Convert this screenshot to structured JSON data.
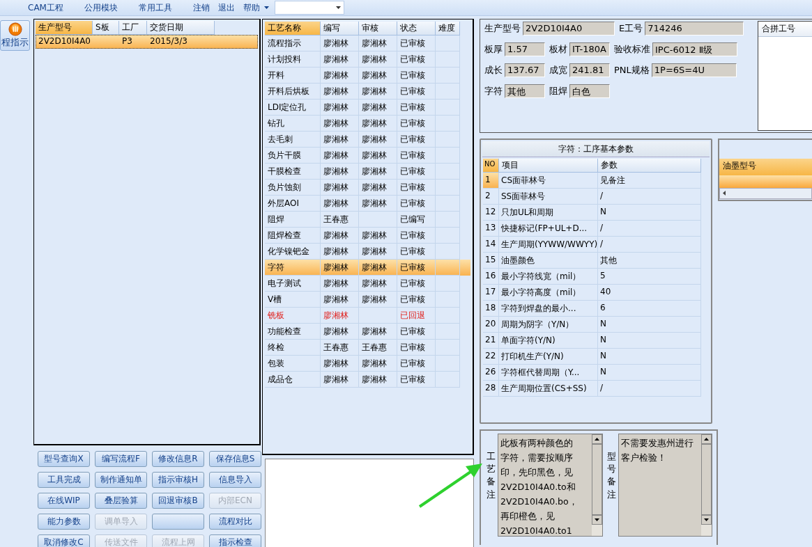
{
  "menu": [
    {
      "label": "CAM工程"
    },
    {
      "label": "公用模块"
    },
    {
      "label": "常用工具"
    },
    {
      "label": "注销"
    },
    {
      "label": "退出"
    },
    {
      "label": "帮助"
    }
  ],
  "side_button": {
    "label": "程指示"
  },
  "model_table": {
    "columns": [
      "生产型号",
      "S板",
      "工厂",
      "交货日期"
    ],
    "rows": [
      {
        "cells": [
          "2V2D10I4A0",
          "",
          "P3",
          "2015/3/3"
        ],
        "selected": true
      }
    ]
  },
  "process_table": {
    "columns": [
      "工艺名称",
      "编写",
      "审核",
      "状态",
      "难度"
    ],
    "rows": [
      {
        "cells": [
          "流程指示",
          "廖湘林",
          "廖湘林",
          "已审核",
          ""
        ],
        "selected": false,
        "returned": false
      },
      {
        "cells": [
          "计划投料",
          "廖湘林",
          "廖湘林",
          "已审核",
          ""
        ],
        "selected": false,
        "returned": false
      },
      {
        "cells": [
          "开料",
          "廖湘林",
          "廖湘林",
          "已审核",
          ""
        ],
        "selected": false,
        "returned": false
      },
      {
        "cells": [
          "开料后烘板",
          "廖湘林",
          "廖湘林",
          "已审核",
          ""
        ],
        "selected": false,
        "returned": false
      },
      {
        "cells": [
          "LDI定位孔",
          "廖湘林",
          "廖湘林",
          "已审核",
          ""
        ],
        "selected": false,
        "returned": false
      },
      {
        "cells": [
          "钻孔",
          "廖湘林",
          "廖湘林",
          "已审核",
          ""
        ],
        "selected": false,
        "returned": false
      },
      {
        "cells": [
          "去毛刺",
          "廖湘林",
          "廖湘林",
          "已审核",
          ""
        ],
        "selected": false,
        "returned": false
      },
      {
        "cells": [
          "负片干膜",
          "廖湘林",
          "廖湘林",
          "已审核",
          ""
        ],
        "selected": false,
        "returned": false
      },
      {
        "cells": [
          "干膜检查",
          "廖湘林",
          "廖湘林",
          "已审核",
          ""
        ],
        "selected": false,
        "returned": false
      },
      {
        "cells": [
          "负片蚀刻",
          "廖湘林",
          "廖湘林",
          "已审核",
          ""
        ],
        "selected": false,
        "returned": false
      },
      {
        "cells": [
          "外层AOI",
          "廖湘林",
          "廖湘林",
          "已审核",
          ""
        ],
        "selected": false,
        "returned": false
      },
      {
        "cells": [
          "阻焊",
          "王春惠",
          "",
          "已编写",
          ""
        ],
        "selected": false,
        "returned": false
      },
      {
        "cells": [
          "阻焊检查",
          "廖湘林",
          "廖湘林",
          "已审核",
          ""
        ],
        "selected": false,
        "returned": false
      },
      {
        "cells": [
          "化学镍钯金",
          "廖湘林",
          "廖湘林",
          "已审核",
          ""
        ],
        "selected": false,
        "returned": false
      },
      {
        "cells": [
          "字符",
          "廖湘林",
          "廖湘林",
          "已审核",
          ""
        ],
        "selected": true,
        "returned": false
      },
      {
        "cells": [
          "电子测试",
          "廖湘林",
          "廖湘林",
          "已审核",
          ""
        ],
        "selected": false,
        "returned": false
      },
      {
        "cells": [
          "V槽",
          "廖湘林",
          "廖湘林",
          "已审核",
          ""
        ],
        "selected": false,
        "returned": false
      },
      {
        "cells": [
          "铣板",
          "廖湘林",
          "",
          "已回退",
          ""
        ],
        "selected": false,
        "returned": true
      },
      {
        "cells": [
          "功能检查",
          "廖湘林",
          "廖湘林",
          "已审核",
          ""
        ],
        "selected": false,
        "returned": false
      },
      {
        "cells": [
          "终检",
          "王春惠",
          "王春惠",
          "已审核",
          ""
        ],
        "selected": false,
        "returned": false
      },
      {
        "cells": [
          "包装",
          "廖湘林",
          "廖湘林",
          "已审核",
          ""
        ],
        "selected": false,
        "returned": false
      },
      {
        "cells": [
          "成品仓",
          "廖湘林",
          "廖湘林",
          "已审核",
          ""
        ],
        "selected": false,
        "returned": false
      }
    ]
  },
  "buttons": [
    {
      "label": "型号查询X",
      "disabled": false
    },
    {
      "label": "编写流程F",
      "disabled": false
    },
    {
      "label": "修改信息R",
      "disabled": false
    },
    {
      "label": "保存信息S",
      "disabled": false
    },
    {
      "label": "工具完成",
      "disabled": false
    },
    {
      "label": "制作通知单",
      "disabled": false
    },
    {
      "label": "指示审核H",
      "disabled": false
    },
    {
      "label": "信息导入",
      "disabled": false
    },
    {
      "label": "在线WIP",
      "disabled": false
    },
    {
      "label": "叠层验算",
      "disabled": false
    },
    {
      "label": "回退审核B",
      "disabled": false
    },
    {
      "label": "内部ECN",
      "disabled": true
    },
    {
      "label": "能力参数",
      "disabled": false
    },
    {
      "label": "调单导入",
      "disabled": true
    },
    {
      "disabled": false
    },
    {
      "label": "流程对比",
      "disabled": false
    },
    {
      "label": "取消修改C",
      "disabled": false
    },
    {
      "label": "传送文件",
      "disabled": true
    },
    {
      "label": "流程上网",
      "disabled": true
    },
    {
      "label": "指示检查",
      "disabled": false
    }
  ],
  "info_fields": [
    {
      "label": "生产型号",
      "value": "2V2D10I4A0",
      "kind": "wide"
    },
    {
      "label": "E工号",
      "value": "714246",
      "kind": "wide"
    },
    {
      "label": "板厚",
      "value": "1.57",
      "kind": "short"
    },
    {
      "label": "板材",
      "value": "IT-180A",
      "kind": "short"
    },
    {
      "label": "验收标准",
      "value": "IPC-6012 Ⅱ级",
      "kind": "wide"
    },
    {
      "label": "成长",
      "value": "137.67",
      "kind": "short"
    },
    {
      "label": "成宽",
      "value": "241.81",
      "kind": "short"
    },
    {
      "label": "PNL规格",
      "value": "1P=6S=4U",
      "kind": "wide"
    },
    {
      "label": "字符",
      "value": "其他",
      "kind": "short"
    },
    {
      "label": "阻焊",
      "value": "白色",
      "kind": "short"
    }
  ],
  "merge_list": {
    "header": "合拼工号"
  },
  "params": {
    "title": "字符：工序基本参数",
    "columns": [
      "NO",
      "项目",
      "参数"
    ],
    "rows": [
      {
        "cells": [
          "1",
          "CS面菲林号",
          "见备注"
        ],
        "selected": true
      },
      {
        "cells": [
          "2",
          "SS面菲林号",
          "/"
        ],
        "selected": false
      },
      {
        "cells": [
          "12",
          "只加UL和周期",
          "N"
        ],
        "selected": false
      },
      {
        "cells": [
          "13",
          "快捷标记(FP+UL+D...",
          "/"
        ],
        "selected": false
      },
      {
        "cells": [
          "14",
          "生产周期(YYWW/WWYY)",
          "/"
        ],
        "selected": false
      },
      {
        "cells": [
          "15",
          "油墨颜色",
          "其他"
        ],
        "selected": false
      },
      {
        "cells": [
          "16",
          "最小字符线宽（mil）",
          "5"
        ],
        "selected": false
      },
      {
        "cells": [
          "17",
          "最小字符高度（mil）",
          "40"
        ],
        "selected": false
      },
      {
        "cells": [
          "18",
          "字符到焊盘的最小...",
          "6"
        ],
        "selected": false
      },
      {
        "cells": [
          "20",
          "周期为阴字（Y/N）",
          "N"
        ],
        "selected": false
      },
      {
        "cells": [
          "21",
          "单面字符(Y/N)",
          "N"
        ],
        "selected": false
      },
      {
        "cells": [
          "22",
          "打印机生产(Y/N)",
          "N"
        ],
        "selected": false
      },
      {
        "cells": [
          "26",
          "字符框代替周期（Y...",
          "N"
        ],
        "selected": false
      },
      {
        "cells": [
          "28",
          "生产周期位置(CS+SS)",
          "/"
        ],
        "selected": false
      }
    ]
  },
  "ink_table": {
    "columns": [
      "油墨型号"
    ]
  },
  "notes": [
    {
      "label": "工艺备注",
      "lines": [
        "此板有两种颜色的",
        "字符，需要按顺序",
        "印，先印黑色，见",
        "2V2D10I4A0.to和",
        "2V2D10I4A0.bo，",
        "再印橙色，见",
        "2V2D10I4A0.to1"
      ]
    },
    {
      "label": "型号备注",
      "lines": [
        "不需要发惠州进行",
        "客户检验！"
      ]
    }
  ]
}
